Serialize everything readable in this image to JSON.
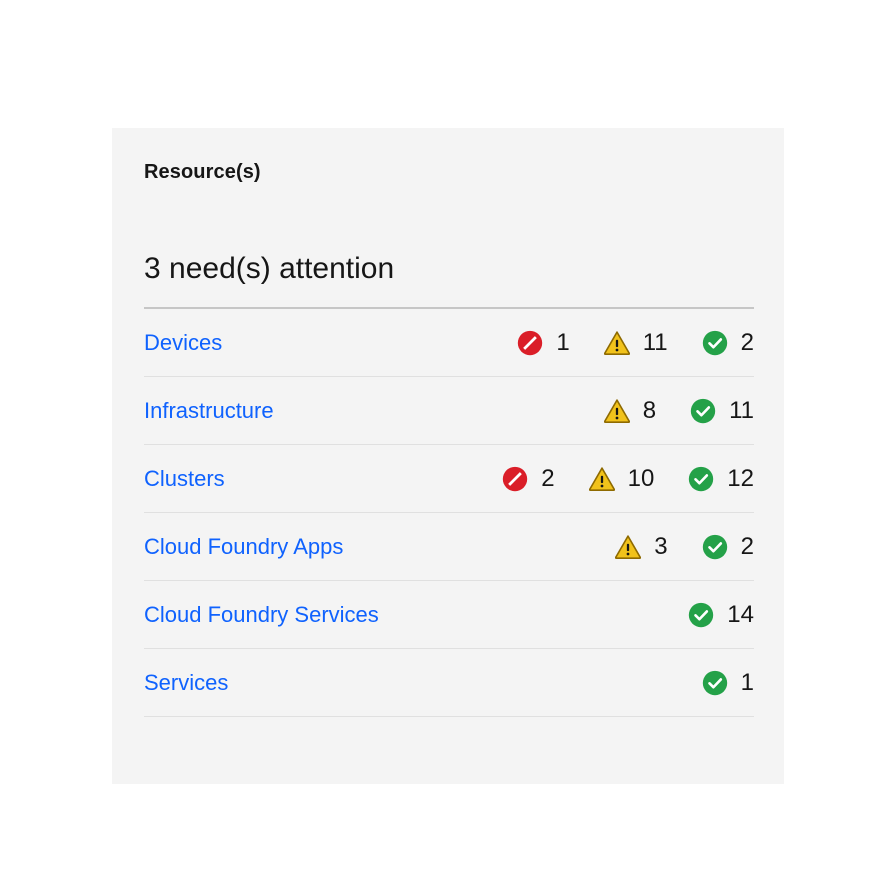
{
  "card": {
    "title": "Resource(s)",
    "attention_summary": "3 need(s) attention"
  },
  "colors": {
    "card_background": "#f4f4f4",
    "page_background": "#ffffff",
    "link": "#0f62fe",
    "text": "#161616",
    "top_rule": "#c6c6c6",
    "row_rule": "#e0e0e0",
    "critical": "#da1e28",
    "warning": "#f1c21b",
    "warning_border": "#8e6a00",
    "ok": "#24a148"
  },
  "status_icon_names": {
    "critical": "critical-slash-icon",
    "warning": "warning-triangle-icon",
    "ok": "ok-check-icon"
  },
  "rows": [
    {
      "label": "Devices",
      "statuses": [
        {
          "kind": "critical",
          "count": "1"
        },
        {
          "kind": "warning",
          "count": "11"
        },
        {
          "kind": "ok",
          "count": "2"
        }
      ]
    },
    {
      "label": "Infrastructure",
      "statuses": [
        {
          "kind": "warning",
          "count": "8"
        },
        {
          "kind": "ok",
          "count": "11"
        }
      ]
    },
    {
      "label": "Clusters",
      "statuses": [
        {
          "kind": "critical",
          "count": "2"
        },
        {
          "kind": "warning",
          "count": "10"
        },
        {
          "kind": "ok",
          "count": "12"
        }
      ]
    },
    {
      "label": "Cloud Foundry Apps",
      "statuses": [
        {
          "kind": "warning",
          "count": "3"
        },
        {
          "kind": "ok",
          "count": "2"
        }
      ]
    },
    {
      "label": "Cloud Foundry Services",
      "statuses": [
        {
          "kind": "ok",
          "count": "14"
        }
      ]
    },
    {
      "label": "Services",
      "statuses": [
        {
          "kind": "ok",
          "count": "1"
        }
      ]
    }
  ]
}
